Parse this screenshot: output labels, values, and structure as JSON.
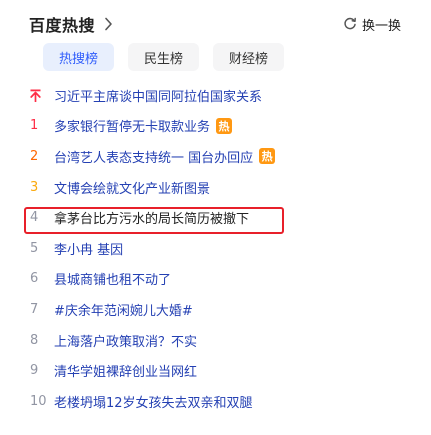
{
  "header": {
    "title": "百度热搜",
    "refresh_label": "换一换"
  },
  "tabs": [
    {
      "label": "热搜榜",
      "active": true
    },
    {
      "label": "民生榜",
      "active": false
    },
    {
      "label": "财经榜",
      "active": false
    }
  ],
  "list": [
    {
      "rank": "",
      "pinned": true,
      "text": "习近平主席谈中国同阿拉伯国家关系",
      "hot": false
    },
    {
      "rank": "1",
      "pinned": false,
      "text": "多家银行暂停无卡取款业务",
      "hot": true
    },
    {
      "rank": "2",
      "pinned": false,
      "text": "台湾艺人表态支持统一 国台办回应",
      "hot": true
    },
    {
      "rank": "3",
      "pinned": false,
      "text": "文博会绘就文化产业新图景",
      "hot": false
    },
    {
      "rank": "4",
      "pinned": false,
      "text": "拿茅台比方污水的局长简历被撤下",
      "hot": false
    },
    {
      "rank": "5",
      "pinned": false,
      "text": "李小冉 基因",
      "hot": false
    },
    {
      "rank": "6",
      "pinned": false,
      "text": "县城商铺也租不动了",
      "hot": false
    },
    {
      "rank": "7",
      "pinned": false,
      "text": "#庆余年范闲婉儿大婚#",
      "hot": false
    },
    {
      "rank": "8",
      "pinned": false,
      "text": "上海落户政策取消？不实",
      "hot": false
    },
    {
      "rank": "9",
      "pinned": false,
      "text": "清华学姐裸辞创业当网红",
      "hot": false
    },
    {
      "rank": "10",
      "pinned": false,
      "text": "老楼坍塌12岁女孩失去双亲和双腿",
      "hot": false
    }
  ],
  "hot_badge_label": "热",
  "colors": {
    "accent": "#315efb",
    "link": "#2440b3",
    "rank1": "#fe2d46",
    "rank2": "#ff6600",
    "rank3": "#faa90e",
    "hot_badge": "#ff9812",
    "highlight": "#e8202a"
  },
  "icons": {
    "title_chevron": "chevron-right-icon",
    "refresh": "refresh-icon",
    "pinned": "pin-top-icon"
  }
}
